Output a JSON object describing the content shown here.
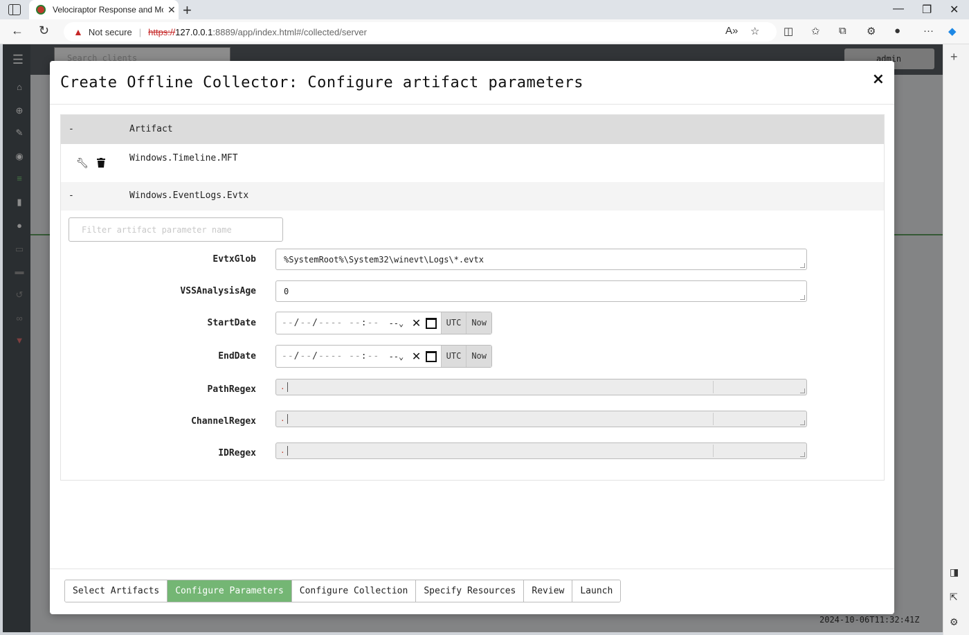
{
  "browser": {
    "tab_title": "Velociraptor Response and Monitoring",
    "not_secure": "Not secure",
    "url_https": "https://",
    "url_host": "127.0.0.1",
    "url_path": ":8889/app/index.html#/collected/server"
  },
  "app": {
    "search_placeholder": "Search clients",
    "user": "admin",
    "status_time": "2024-10-06T11:32:41Z"
  },
  "modal": {
    "title": "Create Offline Collector: Configure artifact parameters",
    "table": {
      "collapse_symbol": "-",
      "header": "Artifact",
      "artifacts": [
        "Windows.Timeline.MFT",
        "Windows.EventLogs.Evtx"
      ]
    },
    "filter_placeholder": "Filter artifact parameter name",
    "params": {
      "evtxglob": {
        "label": "EvtxGlob",
        "value": "%SystemRoot%\\System32\\winevt\\Logs\\*.evtx"
      },
      "vss": {
        "label": "VSSAnalysisAge",
        "value": "0"
      },
      "startdate": {
        "label": "StartDate"
      },
      "enddate": {
        "label": "EndDate"
      },
      "pathregex": {
        "label": "PathRegex",
        "value": "."
      },
      "channelregex": {
        "label": "ChannelRegex",
        "value": "."
      },
      "idregex": {
        "label": "IDRegex",
        "value": "."
      }
    },
    "date": {
      "ampm": "--",
      "utc": "UTC",
      "now": "Now"
    },
    "steps": [
      "Select Artifacts",
      "Configure Parameters",
      "Configure Collection",
      "Specify Resources",
      "Review",
      "Launch"
    ],
    "active_step": "Configure Parameters"
  }
}
